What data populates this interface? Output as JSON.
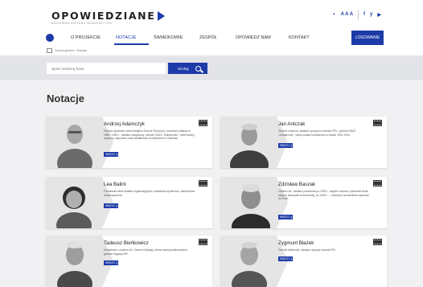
{
  "brand": {
    "name": "OPOWIEDZIANE",
    "subtitle": "ARCHIWUM HISTORII MÓWIONEJ IPN"
  },
  "topbar": {
    "a11y": "A A A",
    "contrast": "◐",
    "social": [
      "f",
      "y",
      "▶"
    ]
  },
  "nav": {
    "items": [
      {
        "label": "O PROJEKCIE"
      },
      {
        "label": "NOTACJE"
      },
      {
        "label": "ŚWIADKOWIE"
      },
      {
        "label": "ZESPÓŁ"
      },
      {
        "label": "OPOWIEDZ NAM"
      },
      {
        "label": "KONTAKT"
      }
    ],
    "login": "LOGOWANIE"
  },
  "breadcrumb": {
    "home": "Strona główna",
    "sep": "/",
    "current": "Notacje"
  },
  "search": {
    "placeholder": "wpisz szukaną frazę",
    "button": "Szukaj"
  },
  "page": {
    "title": "Notacje"
  },
  "cards": [
    {
      "name": "Andrzej Adamczyk",
      "desc": "Historia wydarzeń wokół strajków Stoczni Północnej, uczestnik strajków w 1980 i 1981 r., działacz związkowy, członek NSZZ „Solidarność”, internowany, więziony, wspomina czas działalności na Wybrzeżu w Gdańsku.",
      "more": "WIĘCEJ ❯"
    },
    {
      "name": "Jan Antczak",
      "desc": "Historia rodzinna, działacz opozycji w okresie PRL, członek NSZZ „Solidarność”, radny miasta Konstancina w latach 1991-1994.",
      "more": "WIĘCEJ ❯"
    },
    {
      "name": "Lea Balint",
      "desc": "Prowadziła wiele działań organizacyjnych, działaczka społeczna, założycielka stowarzyszenia.",
      "more": "WIĘCEJ ❯"
    },
    {
      "name": "Zdzisław Baszak",
      "desc": "Żołnierz AK, działacz podziemia po 1939 r., więzień obozów, przeszedł szlak bojowy, kampanie wrześniowej, po 1945 r. — transport uczestników więźniów do Rosji.",
      "more": "WIĘCEJ ❯"
    },
    {
      "name": "Tadeusz Bieńkowicz",
      "desc": "Konspirator i żołnierz AK, Żołnierz Wyklęty, ofiara represji stalinowskich, generał brygady WP.",
      "more": "WIĘCEJ ❯"
    },
    {
      "name": "Zygmunt Błażek",
      "desc": "Technik elektronik, działacz opozycji okresie PRL.",
      "more": "WIĘCEJ ❯"
    }
  ],
  "colors": {
    "accent": "#1d3ba8",
    "background": "#f1f1f3"
  }
}
